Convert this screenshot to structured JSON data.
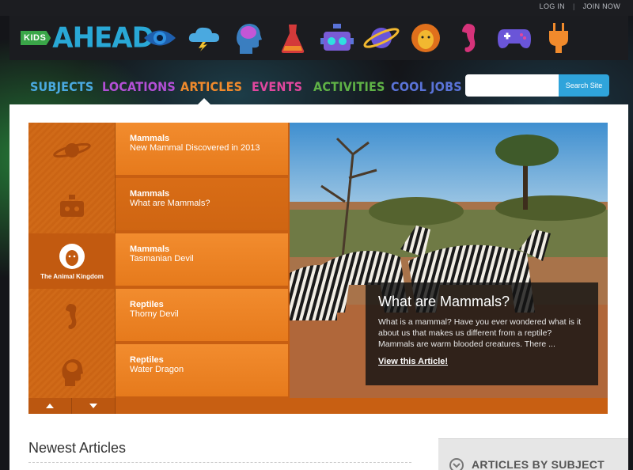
{
  "topbar": {
    "login": "LOG IN",
    "separator": "|",
    "join": "JOIN NOW"
  },
  "logo": {
    "kids": "KIDS",
    "ahead": "AHEAD"
  },
  "category_icons": [
    "eye-icon",
    "storm-cloud-icon",
    "brain-head-icon",
    "flask-icon",
    "robot-icon",
    "planet-icon",
    "lion-icon",
    "seahorse-icon",
    "gamepad-icon",
    "plug-icon"
  ],
  "nav": {
    "items": [
      {
        "label": "SUBJECTS",
        "color": "#4aa9e0"
      },
      {
        "label": "LOCATIONS",
        "color": "#b34fd6"
      },
      {
        "label": "ARTICLES",
        "color": "#f08a2c"
      },
      {
        "label": "EVENTS",
        "color": "#e0479e"
      },
      {
        "label": "ACTIVITIES",
        "color": "#5fb246"
      },
      {
        "label": "COOL JOBS",
        "color": "#5a73d8"
      }
    ],
    "search_placeholder": "",
    "search_button": "Search Site"
  },
  "slider": {
    "active_category_label": "The Animal Kingdom",
    "articles": [
      {
        "category": "Mammals",
        "title": "New Mammal Discovered in 2013"
      },
      {
        "category": "Mammals",
        "title": "What are Mammals?"
      },
      {
        "category": "Mammals",
        "title": "Tasmanian Devil"
      },
      {
        "category": "Reptiles",
        "title": "Thorny Devil"
      },
      {
        "category": "Reptiles",
        "title": "Water Dragon"
      }
    ],
    "caption": {
      "title": "What are Mammals?",
      "text": "What is a mammal? Have you ever wondered what is it about us that makes us different from a reptile? Mammals are warm blooded creatures. There ...",
      "link": "View this Article!"
    }
  },
  "newest_title": "Newest Articles",
  "subject_box_title": "ARTICLES BY SUBJECT",
  "colors": {
    "orange": "#e67a1c",
    "blue": "#2fa4db",
    "green": "#3aa648"
  }
}
